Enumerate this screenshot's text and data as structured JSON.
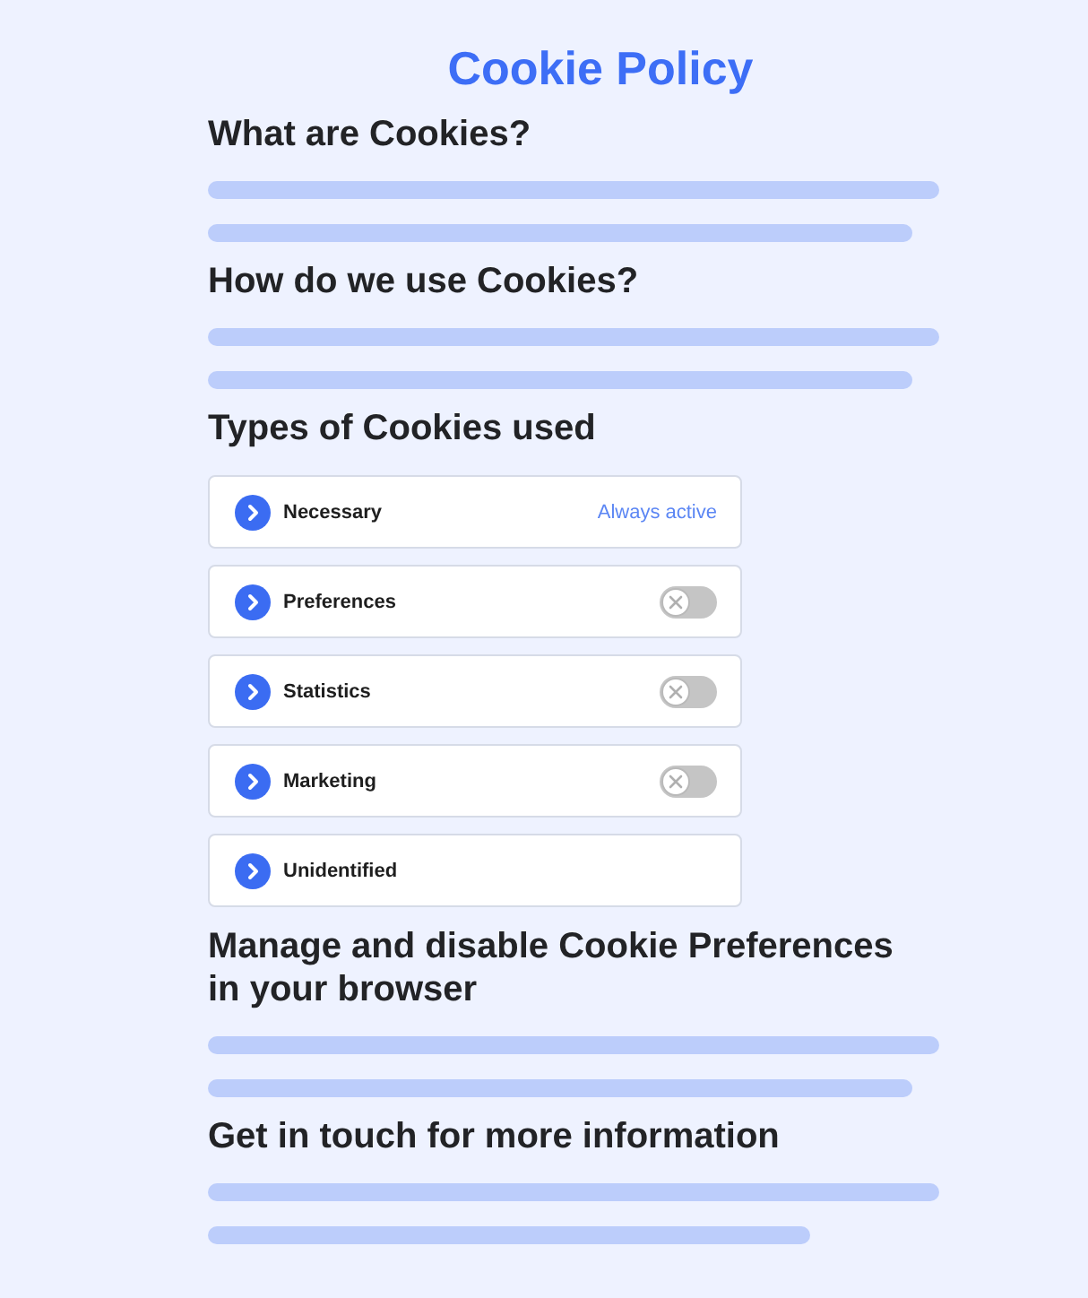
{
  "title": "Cookie Policy",
  "sections": [
    {
      "kind": "text",
      "heading": "What are Cookies?"
    },
    {
      "kind": "text",
      "heading": "How do we use Cookies?"
    },
    {
      "kind": "cookies",
      "heading": "Types of Cookies used",
      "cookies": [
        {
          "name": "Necessary",
          "kind": "status",
          "expanded": false,
          "status": "Always active"
        },
        {
          "name": "Preferences",
          "kind": "toggle",
          "expanded": false,
          "on": false
        },
        {
          "name": "Statistics",
          "kind": "toggle",
          "expanded": false,
          "on": false
        },
        {
          "name": "Marketing",
          "kind": "toggle",
          "expanded": false,
          "on": false
        },
        {
          "name": "Unidentified",
          "kind": "plain",
          "expanded": false
        }
      ]
    },
    {
      "kind": "text",
      "heading": "Manage and disable Cookie Preferences in your browser"
    },
    {
      "kind": "text",
      "heading": "Get in touch for more information"
    }
  ]
}
